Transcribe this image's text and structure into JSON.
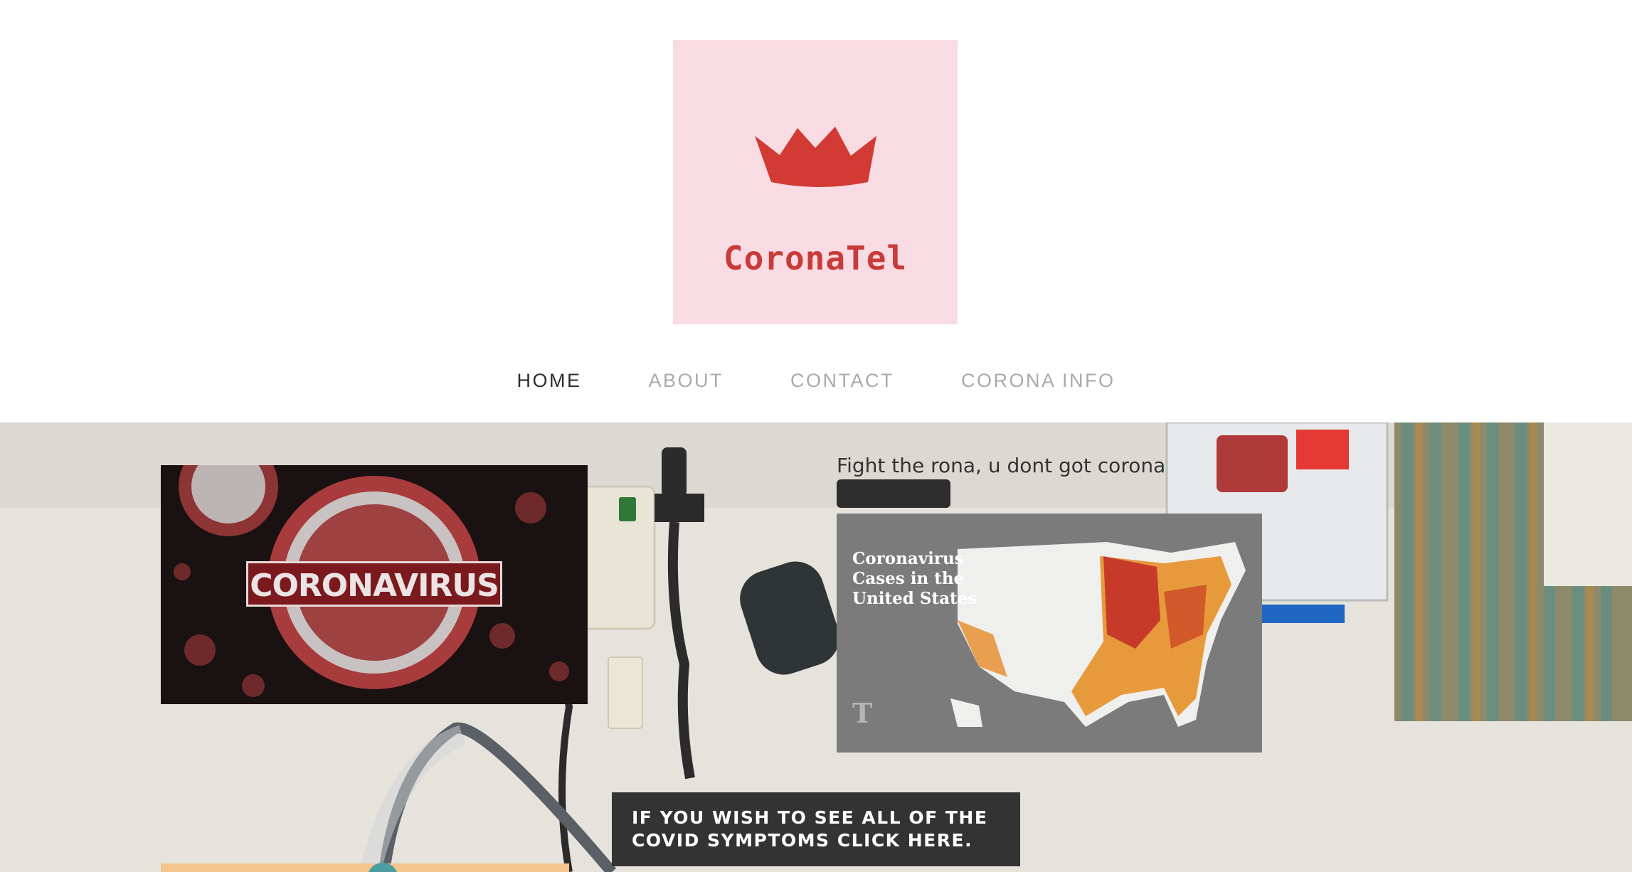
{
  "header": {
    "logo": {
      "text": "CoronaTel",
      "icon": "crown-icon",
      "background_color": "#f9dbe3",
      "accent_color": "#d23a34"
    },
    "nav": {
      "items": [
        {
          "label": "HOME",
          "active": true
        },
        {
          "label": "ABOUT",
          "active": false
        },
        {
          "label": "CONTACT",
          "active": false
        },
        {
          "label": "CORONA INFO",
          "active": false
        }
      ]
    }
  },
  "hero": {
    "tagline": "Fight the rona, u dont got corona",
    "virus_image": {
      "label": "CORONAVIRUS"
    },
    "map_image": {
      "title": "Coronavirus\nCases in the\nUnited States",
      "logo": "T"
    },
    "cta": {
      "label": "IF YOU WISH TO SEE ALL OF THE COVID SYMPTOMS CLICK HERE."
    }
  }
}
